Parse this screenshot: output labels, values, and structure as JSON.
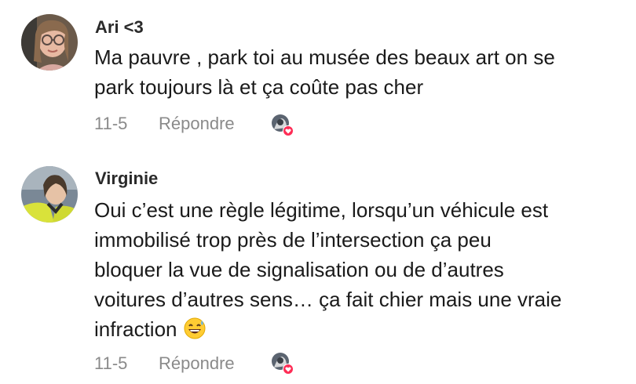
{
  "comments": [
    {
      "username": "Ari <3",
      "lines": [
        "Ma pauvre , park toi au musée des beaux art on se",
        "park toujours là et ça coûte pas cher"
      ],
      "date": "11-5",
      "reply_label": "Répondre",
      "avatar_icon": "user-avatar-photo",
      "liker_icon": "creator-liked-heart-avatar"
    },
    {
      "username": "Virginie",
      "lines": [
        "Oui c’est une règle légitime, lorsqu’un véhicule est",
        "immobilisé trop près de l’intersection ça peu",
        "bloquer la vue de signalisation ou de d’autres",
        "voitures d’autres sens… ça fait chier mais une vraie",
        "infraction"
      ],
      "emoji": "grinning-face-with-sweat-emoji",
      "date": "11-5",
      "reply_label": "Répondre",
      "avatar_icon": "user-avatar-photo",
      "liker_icon": "creator-liked-heart-avatar"
    }
  ],
  "colors": {
    "username": "#2a2a2a",
    "text": "#1a1a1a",
    "meta": "#8a8a8a",
    "heart_badge": "#fe2c55"
  }
}
